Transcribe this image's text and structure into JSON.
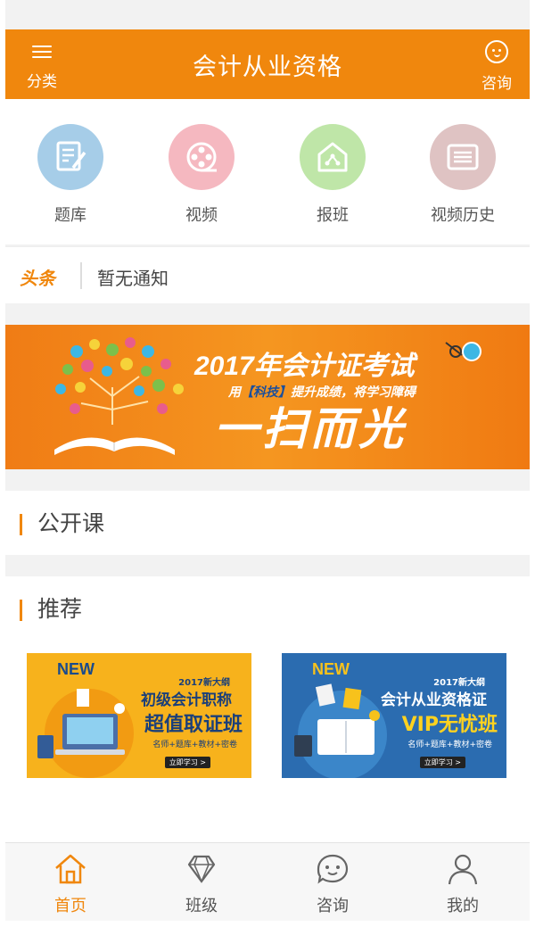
{
  "header": {
    "menu_label": "分类",
    "title": "会计从业资格",
    "consult_label": "咨询"
  },
  "quick_nav": [
    {
      "label": "题库",
      "icon": "question-bank-icon",
      "color": "#a6cde8"
    },
    {
      "label": "视频",
      "icon": "film-reel-icon",
      "color": "#f5b8c0"
    },
    {
      "label": "报班",
      "icon": "house-enroll-icon",
      "color": "#bfe6a8"
    },
    {
      "label": "视频历史",
      "icon": "history-list-icon",
      "color": "#dfc3c3"
    }
  ],
  "headline": {
    "tag": "头条",
    "text": "暂无通知"
  },
  "banner": {
    "title": "2017年会计证考试",
    "subtitle_pre": "用",
    "subtitle_highlight": "【科技】",
    "subtitle_post": "提升成绩，将学习障碍",
    "slogan": "一扫而光"
  },
  "sections": {
    "open_course": "公开课",
    "recommend": "推荐"
  },
  "recommend": [
    {
      "badge": "NEW",
      "year": "2017新大纲",
      "line1": "初级会计职称",
      "line2": "超值取证班",
      "line3": "名师+题库+教材+密卷",
      "cta": "立即学习 >",
      "bg": "#f7b21c",
      "badge_color": "#1a4b8c",
      "text_color": "#1a3f7a",
      "line2_color": "#1a3f7a"
    },
    {
      "badge": "NEW",
      "year": "2017新大纲",
      "line1": "会计从业资格证",
      "line2": "VIP无忧班",
      "line3": "名师+题库+教材+密卷",
      "cta": "立即学习 >",
      "bg": "#2b6cb0",
      "badge_color": "#f7c21c",
      "text_color": "#ffffff",
      "line2_color": "#ffd21f"
    }
  ],
  "tabbar": [
    {
      "label": "首页",
      "icon": "home-icon",
      "active": true
    },
    {
      "label": "班级",
      "icon": "diamond-icon",
      "active": false
    },
    {
      "label": "咨询",
      "icon": "chat-face-icon",
      "active": false
    },
    {
      "label": "我的",
      "icon": "user-icon",
      "active": false
    }
  ],
  "colors": {
    "accent": "#f0870d",
    "background": "#f2f2f2"
  }
}
